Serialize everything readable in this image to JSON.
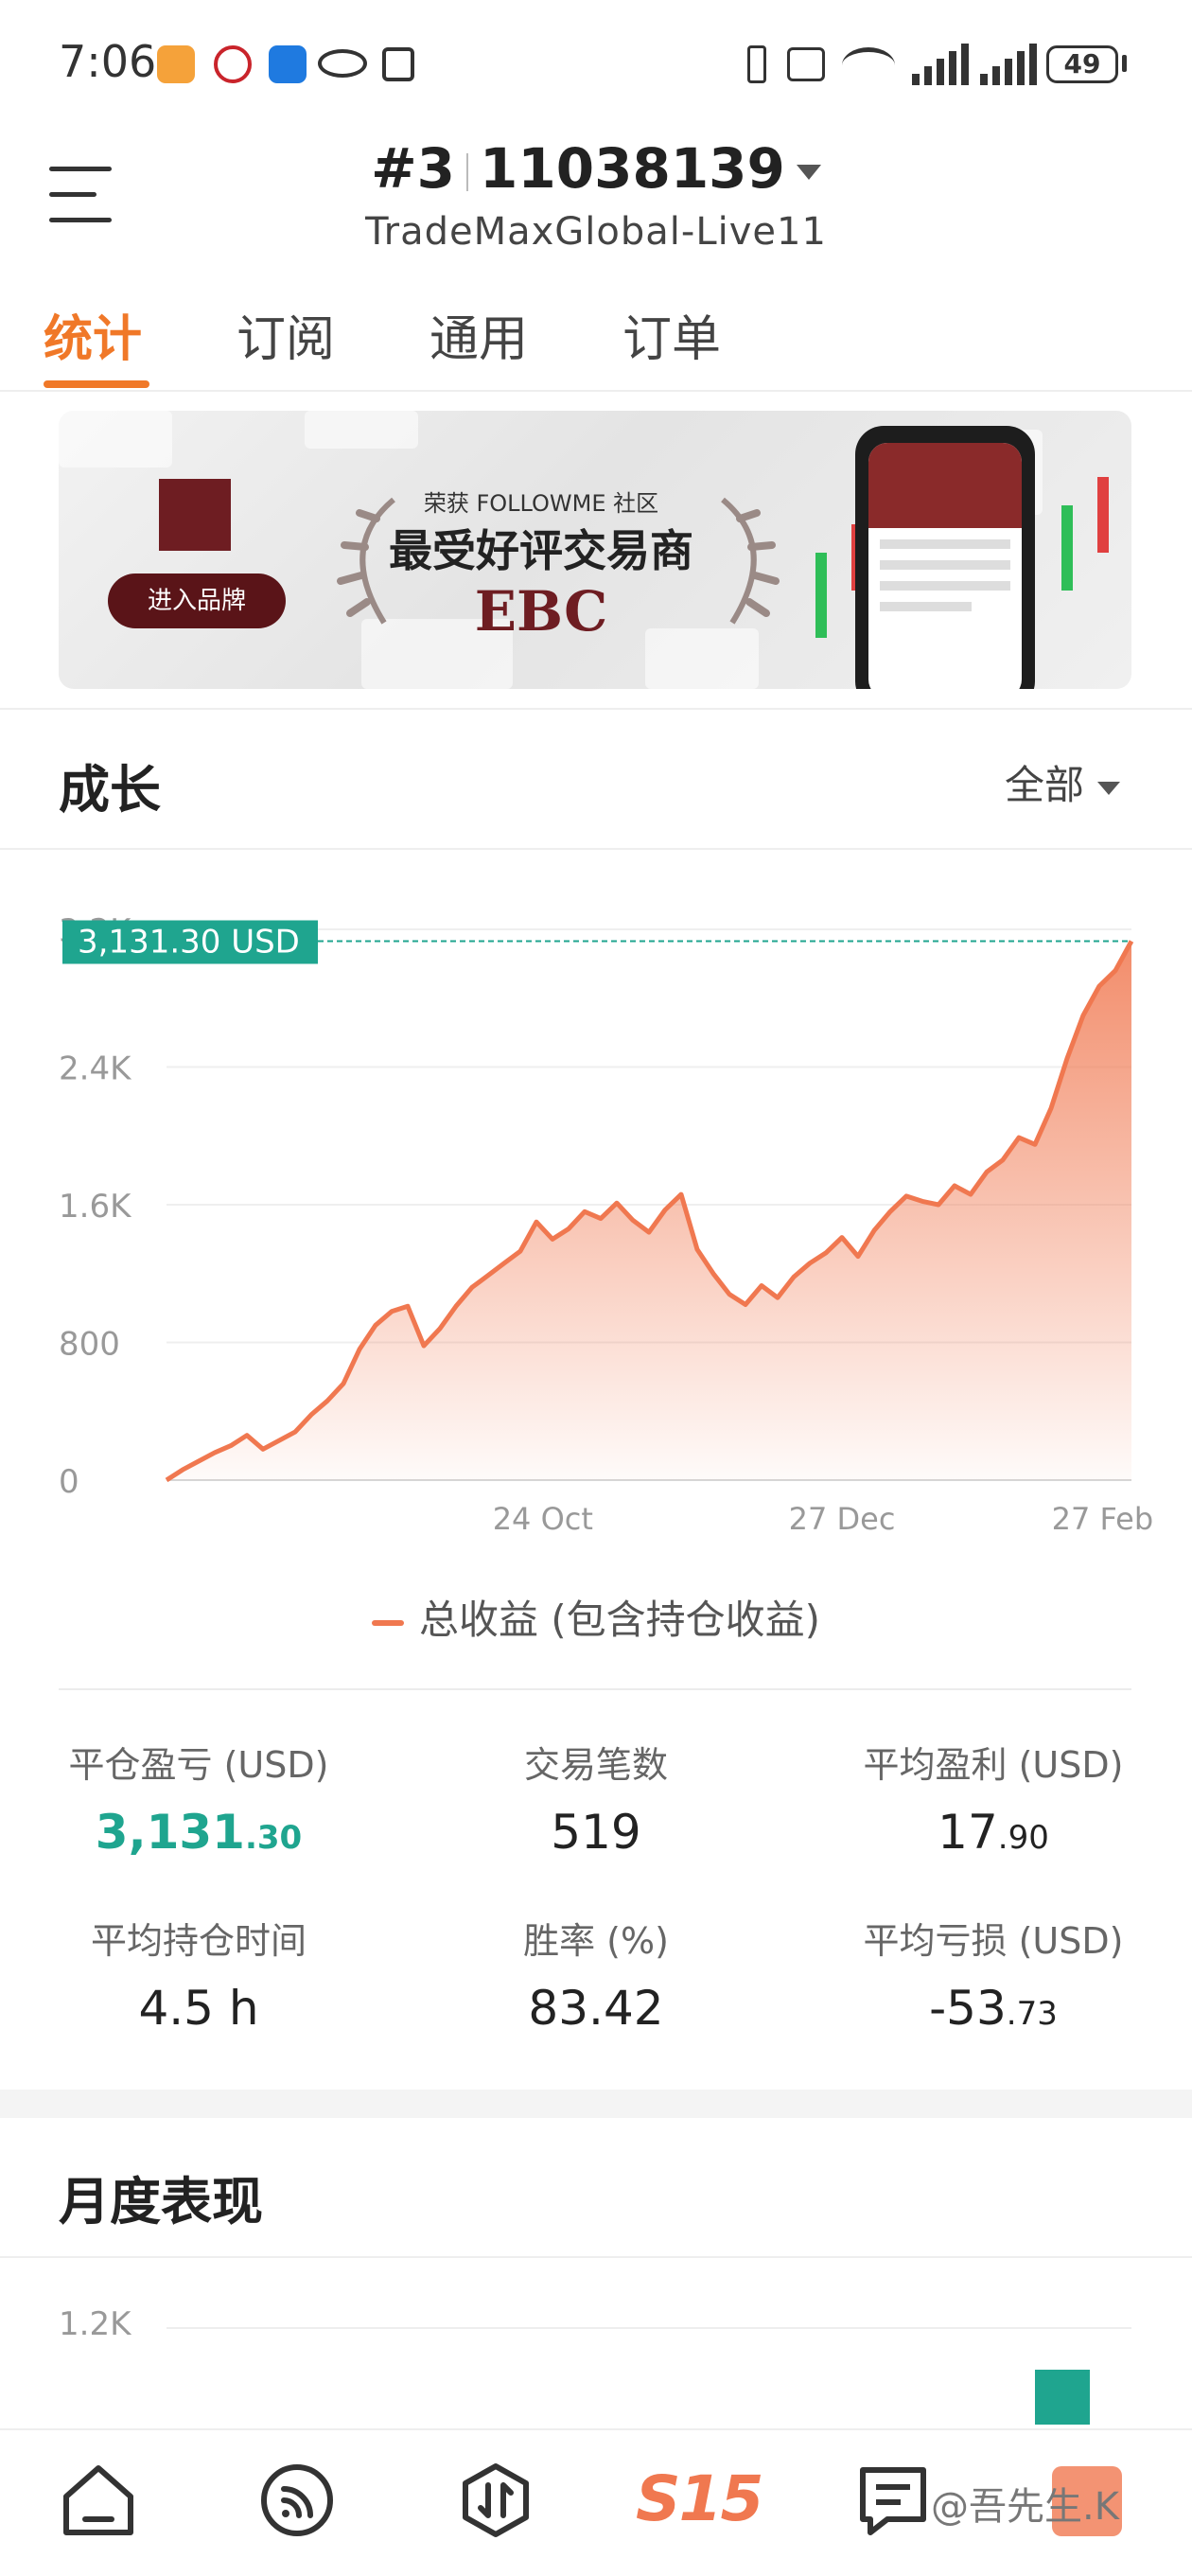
{
  "status_bar": {
    "time": "7:06",
    "battery": "49"
  },
  "header": {
    "account_prefix": "#3",
    "account_number": "11038139",
    "server": "TradeMaxGlobal-Live11"
  },
  "tabs": [
    {
      "label": "统计",
      "active": true
    },
    {
      "label": "订阅",
      "active": false
    },
    {
      "label": "通用",
      "active": false
    },
    {
      "label": "订单",
      "active": false
    }
  ],
  "banner": {
    "award_small": "荣获 FOLLOWME 社区",
    "award_big": "最受好评交易商",
    "brand": "EBC",
    "button": "进入品牌"
  },
  "growth": {
    "title": "成长",
    "filter": "全部",
    "legend": "总收益 (包含持仓收益)"
  },
  "chart_data": {
    "type": "area",
    "y_ticks": [
      "0",
      "800",
      "1.6K",
      "2.4K",
      "3.2K"
    ],
    "x_ticks": [
      "24 Oct",
      "27 Dec",
      "27 Feb"
    ],
    "ylim": [
      0,
      3200
    ],
    "current_label": "3,131.30 USD",
    "series": [
      {
        "name": "总收益 (包含持仓收益)",
        "color": "#f07850",
        "values": [
          0,
          60,
          110,
          160,
          200,
          260,
          180,
          230,
          280,
          380,
          460,
          560,
          760,
          900,
          980,
          1010,
          780,
          880,
          1010,
          1120,
          1190,
          1260,
          1330,
          1500,
          1400,
          1460,
          1560,
          1520,
          1610,
          1510,
          1440,
          1570,
          1660,
          1340,
          1200,
          1080,
          1020,
          1130,
          1060,
          1180,
          1260,
          1320,
          1410,
          1300,
          1450,
          1560,
          1650,
          1620,
          1600,
          1710,
          1660,
          1790,
          1860,
          1990,
          1950,
          2160,
          2450,
          2700,
          2870,
          2960,
          3131.3
        ]
      }
    ]
  },
  "stats": [
    {
      "label": "平仓盈亏 (USD)",
      "int": "3,131",
      "dec": ".30",
      "highlight": true
    },
    {
      "label": "交易笔数",
      "int": "519",
      "dec": ""
    },
    {
      "label": "平均盈利 (USD)",
      "int": "17",
      "dec": ".90"
    },
    {
      "label": "平均持仓时间",
      "int": "4.5 h",
      "dec": ""
    },
    {
      "label": "胜率 (%)",
      "int": "83.42",
      "dec": ""
    },
    {
      "label": "平均亏损 (USD)",
      "int": "-53",
      "dec": ".73"
    }
  ],
  "monthly": {
    "title": "月度表现",
    "y_label": "1.2K"
  },
  "nav": [
    {
      "name": "home",
      "label": ""
    },
    {
      "name": "community",
      "label": ""
    },
    {
      "name": "trade",
      "label": ""
    },
    {
      "name": "s15",
      "label": "S15"
    },
    {
      "name": "messages",
      "label": ""
    }
  ],
  "watermark": "@吾先生.K"
}
